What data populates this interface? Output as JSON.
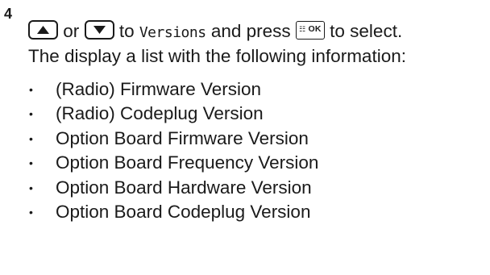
{
  "step": {
    "number": "4",
    "connector_or": "or",
    "connector_to": "to",
    "menu_term": "Versions",
    "and_press": "and press",
    "ok_key_glyph": "☷",
    "ok_key_label": "OK",
    "to_select": "to select.",
    "description": "The display a list with the following information:",
    "up_key_icon": "up-arrow-key-icon",
    "down_key_icon": "down-arrow-key-icon"
  },
  "items": [
    {
      "bullet": "•",
      "label": "(Radio) Firmware Version"
    },
    {
      "bullet": "•",
      "label": "(Radio) Codeplug Version"
    },
    {
      "bullet": "•",
      "label": "Option Board Firmware Version"
    },
    {
      "bullet": "•",
      "label": "Option Board Frequency Version"
    },
    {
      "bullet": "•",
      "label": "Option Board Hardware Version"
    },
    {
      "bullet": "•",
      "label": "Option Board Codeplug Version"
    }
  ]
}
